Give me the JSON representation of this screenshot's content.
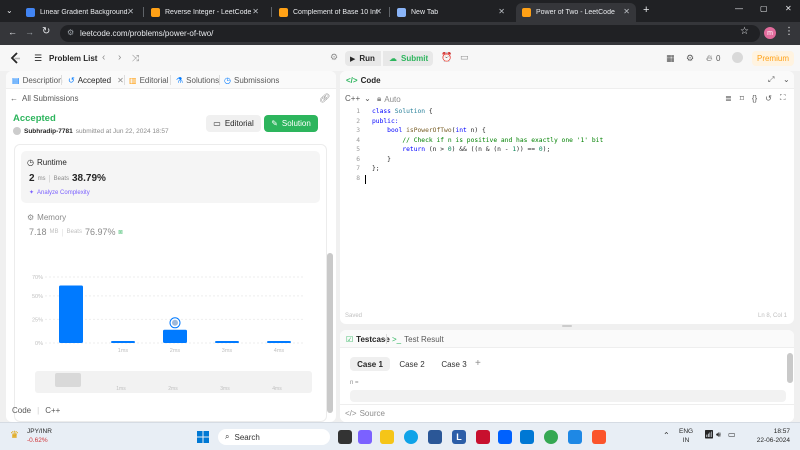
{
  "browser": {
    "tabs": [
      {
        "label": "Linear Gradient Background.",
        "favicon_color": "#4285f4",
        "active": false
      },
      {
        "label": "Reverse Integer - LeetCode",
        "favicon_color": "#ffa116",
        "active": false
      },
      {
        "label": "Complement of Base 10 Integ",
        "favicon_color": "#ffa116",
        "active": false
      },
      {
        "label": "New Tab",
        "favicon_color": "#8ab4f8",
        "active": false
      },
      {
        "label": "Power of Two - LeetCode",
        "favicon_color": "#ffa116",
        "active": true
      }
    ],
    "new_tab": "+",
    "url": "leetcode.com/problems/power-of-two/",
    "profile_initial": "m",
    "window_controls": [
      "—",
      "▢",
      "✕"
    ]
  },
  "header": {
    "problem_list": "Problem List",
    "run": "Run",
    "submit": "Submit",
    "streak": "0",
    "premium": "Premium"
  },
  "left": {
    "tabs": [
      {
        "label": "Description",
        "icon": "doc-icon"
      },
      {
        "label": "Accepted",
        "icon": "history-icon",
        "closable": true
      },
      {
        "label": "Editorial",
        "icon": "book-icon"
      },
      {
        "label": "Solutions",
        "icon": "flask-icon"
      },
      {
        "label": "Submissions",
        "icon": "clock-icon"
      }
    ],
    "back_link": "All Submissions",
    "status": "Accepted",
    "user": "Subhradip-7781",
    "submitted": "submitted at Jun 22, 2024 18:57",
    "editorial_btn": "Editorial",
    "solution_btn": "Solution",
    "runtime": {
      "label": "Runtime",
      "value": "2",
      "unit": "ms",
      "beats_label": "Beats",
      "beats": "38.79%",
      "analyze": "Analyze Complexity"
    },
    "memory": {
      "label": "Memory",
      "value": "7.18",
      "unit": "MB",
      "beats_label": "Beats",
      "beats": "76.97%"
    },
    "footer": {
      "code": "Code",
      "lang": "C++"
    }
  },
  "chart_data": {
    "type": "bar",
    "categories": [
      "0ms",
      "1ms",
      "2ms",
      "3ms",
      "4ms"
    ],
    "x_tick_labels": [
      "1ms",
      "2ms",
      "3ms",
      "4ms"
    ],
    "values": [
      61,
      2,
      14,
      2,
      2
    ],
    "highlight_index": 2,
    "y_ticks": [
      "70%",
      "50%",
      "25%",
      "0%"
    ],
    "ylim": [
      0,
      70
    ],
    "bar_color": "#007aff",
    "minimap_labels": [
      "1ms",
      "2ms",
      "3ms",
      "4ms"
    ]
  },
  "editor": {
    "title": "Code",
    "lang": "C++",
    "mode": "Auto",
    "lines": [
      [
        {
          "t": "class ",
          "c": "kw"
        },
        {
          "t": "Solution",
          "c": "ty"
        },
        {
          "t": " {",
          "c": ""
        }
      ],
      [
        {
          "t": "public:",
          "c": "kw"
        }
      ],
      [
        {
          "t": "    ",
          "c": ""
        },
        {
          "t": "bool ",
          "c": "kw"
        },
        {
          "t": "isPowerOfTwo",
          "c": "fn"
        },
        {
          "t": "(",
          "c": ""
        },
        {
          "t": "int",
          "c": "kw"
        },
        {
          "t": " n) {",
          "c": ""
        }
      ],
      [
        {
          "t": "        // Check if n is positive and has exactly one '1' bit",
          "c": "cm"
        }
      ],
      [
        {
          "t": "        ",
          "c": ""
        },
        {
          "t": "return",
          "c": "kw"
        },
        {
          "t": " (n > ",
          "c": ""
        },
        {
          "t": "0",
          "c": "num"
        },
        {
          "t": ") && ((n & (n - ",
          "c": ""
        },
        {
          "t": "1",
          "c": "num"
        },
        {
          "t": ")) == ",
          "c": ""
        },
        {
          "t": "0",
          "c": "num"
        },
        {
          "t": ");",
          "c": ""
        }
      ],
      [
        {
          "t": "    }",
          "c": ""
        }
      ],
      [
        {
          "t": "};",
          "c": ""
        }
      ],
      [
        {
          "t": "",
          "c": ""
        }
      ]
    ],
    "saved": "Saved",
    "cursor": "Ln 8, Col 1"
  },
  "testcase": {
    "tab": "Testcase",
    "result_tab": "Test Result",
    "cases": [
      "Case 1",
      "Case 2",
      "Case 3"
    ],
    "add": "+",
    "var": "n =",
    "source": "Source"
  },
  "taskbar": {
    "currency": "JPY/INR",
    "change": "-0.62%",
    "search": "Search",
    "lang1": "ENG",
    "lang2": "IN",
    "time": "18:57",
    "date": "22-06-2024"
  }
}
